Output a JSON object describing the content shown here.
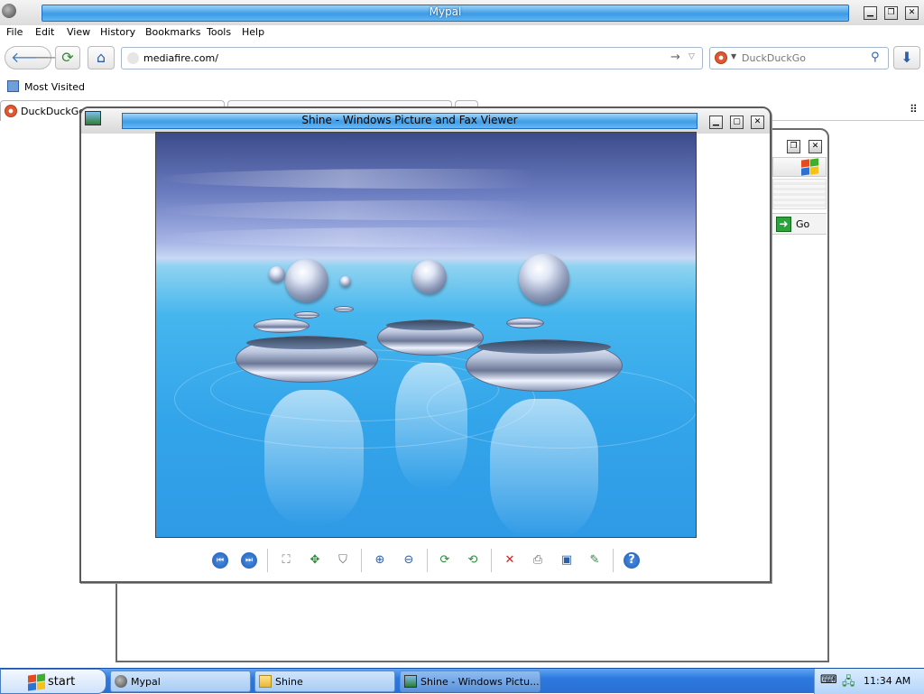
{
  "browser": {
    "title": "Mypal",
    "menu": [
      "File",
      "Edit",
      "View",
      "History",
      "Bookmarks",
      "Tools",
      "Help"
    ],
    "url": "mediafire.com/",
    "search_engine": "DuckDuckGo",
    "search_placeholder": "DuckDuckGo",
    "bookmark_label": "Most Visited",
    "tabs": [
      {
        "label": "DuckDuckGo —"
      },
      {
        "label": ""
      },
      {
        "label": ""
      }
    ]
  },
  "explorer": {
    "go_label": "Go"
  },
  "viewer": {
    "title": "Shine - Windows Picture and Fax Viewer",
    "image_name": "Shine",
    "tools": [
      "previous-image-icon",
      "next-image-icon",
      "best-fit-icon",
      "actual-size-icon",
      "slideshow-icon",
      "zoom-in-icon",
      "zoom-out-icon",
      "rotate-clockwise-icon",
      "rotate-counterclockwise-icon",
      "delete-icon",
      "print-icon",
      "save-icon",
      "edit-icon",
      "help-icon"
    ]
  },
  "taskbar": {
    "start_label": "start",
    "tasks": [
      {
        "label": "Mypal",
        "icon": "mypal-icon"
      },
      {
        "label": "Shine",
        "icon": "folder-icon"
      },
      {
        "label": "Shine - Windows Pictu...",
        "icon": "picture-viewer-icon"
      }
    ],
    "clock": "11:34 AM"
  },
  "colors": {
    "titlebar_blue": "#3c9be6",
    "taskbar_blue": "#2c79de",
    "go_green": "#2aa43a",
    "delete_red": "#d32020"
  }
}
